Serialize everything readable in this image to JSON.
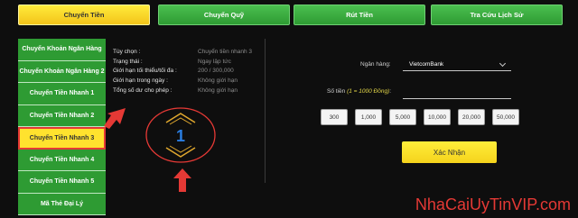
{
  "tabs": [
    {
      "label": "Chuyển Tiền"
    },
    {
      "label": "Chuyển Quỹ"
    },
    {
      "label": "Rút Tiền"
    },
    {
      "label": "Tra Cứu Lịch Sử"
    }
  ],
  "sidebar": {
    "items": [
      {
        "label": "Chuyển Khoản Ngân Hàng"
      },
      {
        "label": "Chuyển Khoản Ngân Hàng 2"
      },
      {
        "label": "Chuyển Tiền Nhanh 1"
      },
      {
        "label": "Chuyển Tiền Nhanh 2"
      },
      {
        "label": "Chuyển Tiền Nhanh 3"
      },
      {
        "label": "Chuyển Tiền Nhanh 4"
      },
      {
        "label": "Chuyển Tiền Nhanh 5"
      },
      {
        "label": "Mã Thẻ Đại Lý"
      }
    ]
  },
  "info": {
    "rows": [
      {
        "label": "Tùy chọn :",
        "value": "Chuyển tiền nhanh 3"
      },
      {
        "label": "Trạng thái :",
        "value": "Ngay lập tức"
      },
      {
        "label": "Giới hạn tối thiểu/tối đa :",
        "value": "200 / 300,000"
      },
      {
        "label": "Giới hạn trong ngày :",
        "value": "Không giới hạn"
      },
      {
        "label": "Tổng số dư cho phép :",
        "value": "Không giới hạn"
      }
    ]
  },
  "badge": {
    "number": "1"
  },
  "form": {
    "bank_label": "Ngân hàng:",
    "bank_value": "VietcomBank",
    "amount_label": "Số tiền",
    "amount_note": "(1 = 1000 Đồng)",
    "amount_suffix": ":",
    "amount_options": [
      "300",
      "1,000",
      "5,000",
      "10,000",
      "20,000",
      "50,000"
    ],
    "submit_label": "Xác Nhận"
  },
  "watermark": "NhaCaiUyTinVIP.com",
  "colors": {
    "accent_yellow": "#ffe22e",
    "nav_green": "#2e9b33",
    "annotation_red": "#e53935",
    "badge_blue": "#2a7de1"
  }
}
